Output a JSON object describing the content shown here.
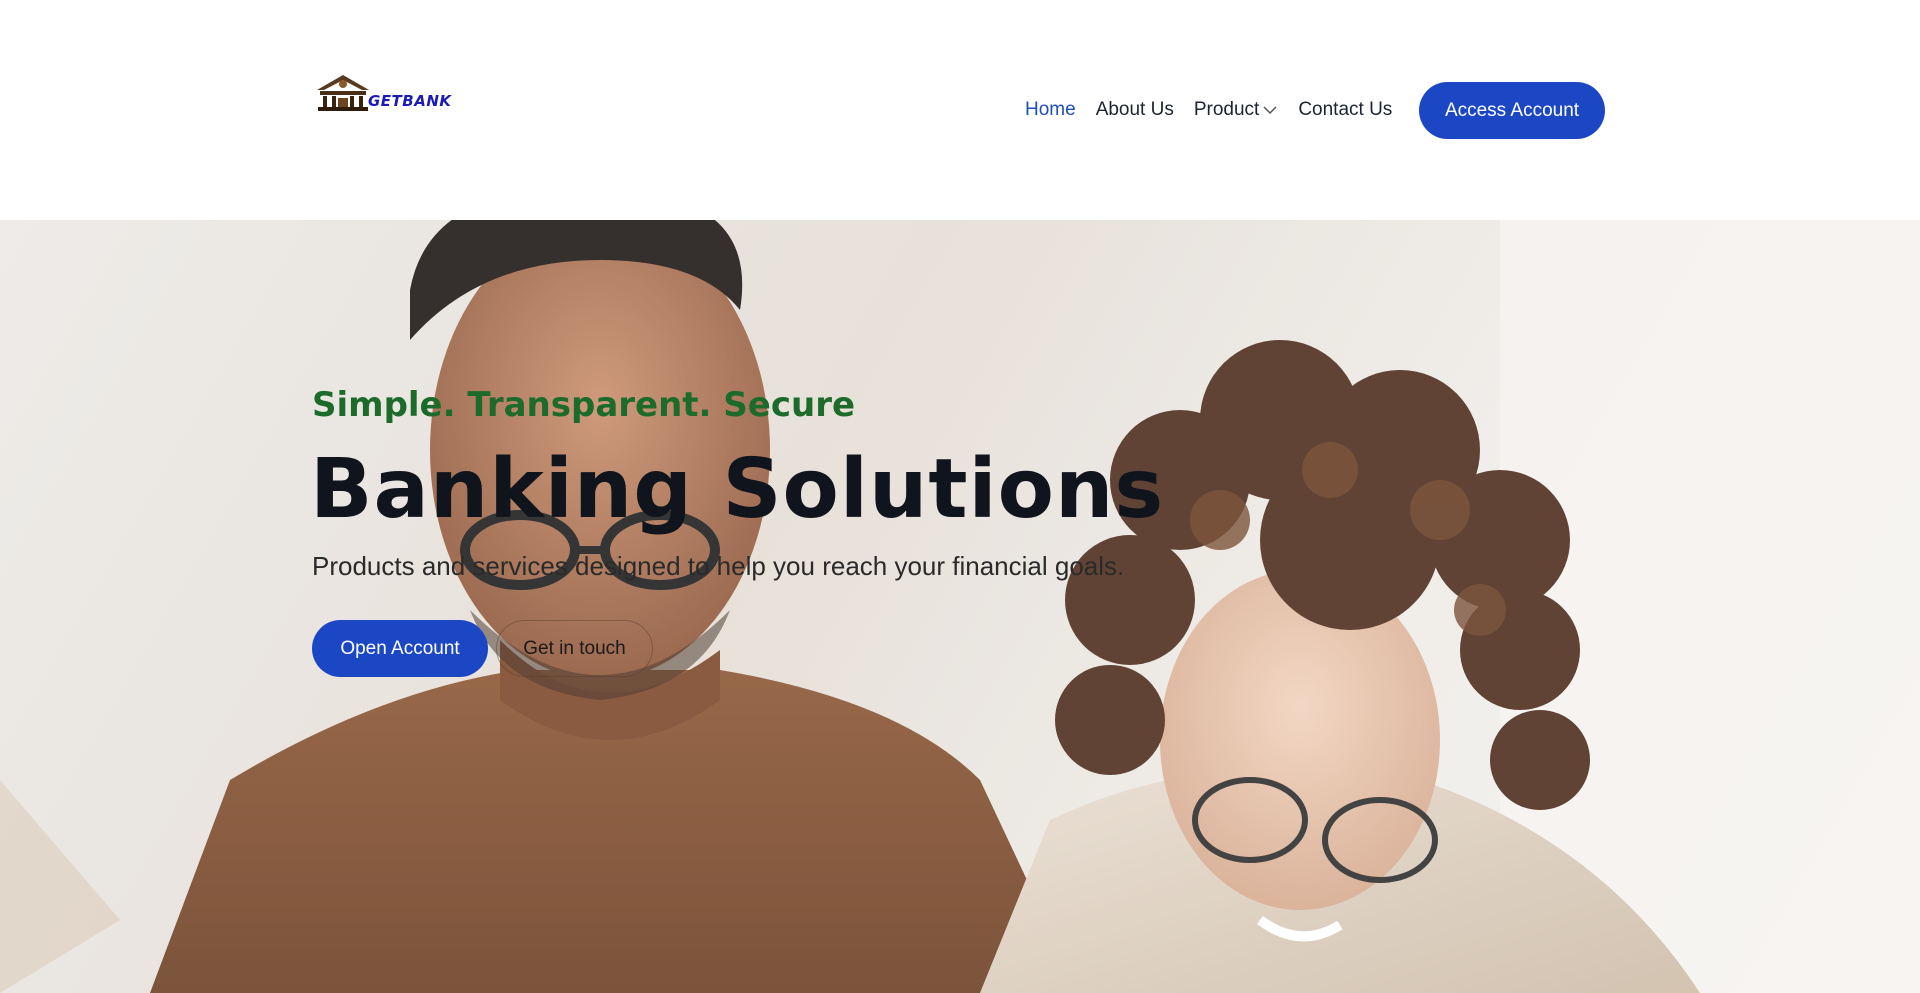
{
  "header": {
    "logo_text": "GETBANK",
    "nav": {
      "home": "Home",
      "about": "About Us",
      "product": "Product",
      "contact": "Contact Us"
    },
    "access_button": "Access Account"
  },
  "hero": {
    "tagline": "Simple. Transparent. Secure",
    "headline": "Banking Solutions",
    "subtitle": "Products and services designed to help you reach your financial goals.",
    "primary_button": "Open Account",
    "secondary_button": "Get in touch"
  },
  "colors": {
    "brand_blue": "#1b47c5",
    "nav_active": "#1f4fb8",
    "tagline_green": "#1d6b2a",
    "headline_dark": "#10141c"
  },
  "icons": {
    "logo": "bank-building-logo-icon",
    "product_dropdown": "chevron-down-icon"
  }
}
